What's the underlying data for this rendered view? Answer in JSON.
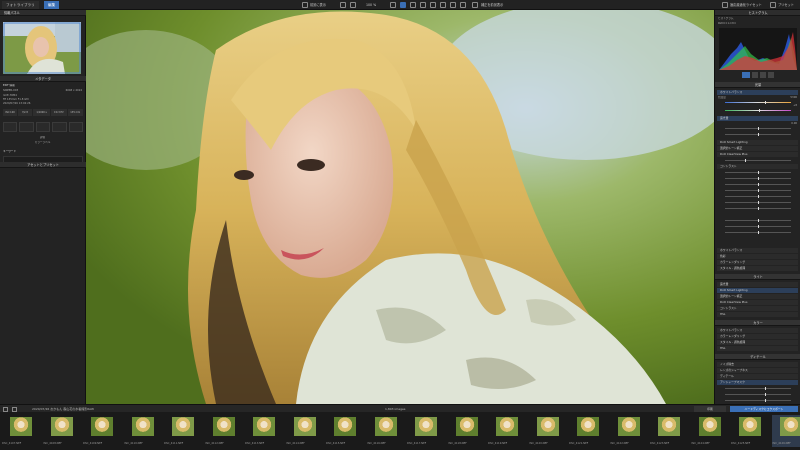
{
  "top_bar": {
    "tabs": [
      "フォトライブラリ",
      "編集"
    ],
    "buttons": [
      "前景に表示",
      "100 %",
      "補正を前景表示"
    ],
    "right_buttons": [
      "適応最適化ライセット",
      "プリセット"
    ]
  },
  "left_panel": {
    "title_navigator": "情報パネル",
    "metadata_header": "メタデータ",
    "exif_header": "EXIF 情報",
    "file_name": "SNIPER-003",
    "dims": "6048 x 4024",
    "camera": "ILCE-7RM4",
    "lens": "FE 135mm F1.8 GM",
    "date": "2020/07/26 13:02:26",
    "params": [
      "ISO 100",
      "f/2.8",
      "1/1000 s",
      "±0.3 EV",
      "135 mm"
    ],
    "keywords_header": "キーワード",
    "rating_label": "評価",
    "color_label": "カラーラベル",
    "assets_header": "アセットとプリセット"
  },
  "right_panel": {
    "histogram_header": "ヒストグラム",
    "histogram_label": "ヒストグラム",
    "histogram_info": "RGB R 0 G 0 B 0",
    "sections": [
      "ホワイトバランス",
      "露光量",
      "DxO Smart Lighting",
      "選択的トーン補正",
      "DxO ClearView Plus",
      "コントラスト",
      "ホワイトバランス",
      "色彩",
      "カラーレンダリング",
      "スタイル - 調色処理",
      "HSL",
      "ディテール",
      "ノイズ除去",
      "レンズのシャープネス",
      "アンシャープマスク"
    ],
    "group_headers": [
      "光量",
      "ライト",
      "カラー",
      "ディテール"
    ],
    "wb_values": [
      "5300",
      "+8"
    ],
    "exposure_value": "0.00",
    "export_button": "ハードディスクにエクスポート"
  },
  "filmstrip": {
    "folder": "2020/07/26 おかもん 森山花の水着撮影RAW",
    "count": "1,803 images",
    "print_button": "印刷",
    "thumbnails": [
      "DSC_4107.NEF",
      "DSC_4108.NEF",
      "DSC_4109.NEF",
      "DSC_4110.NEF",
      "DSC_4111.NEF",
      "DSC_4112.NEF",
      "DSC_4113.NEF",
      "DSC_4114.NEF",
      "DSC_4115.NEF",
      "DSC_4116.NEF",
      "DSC_4117.NEF",
      "DSC_4118.NEF",
      "DSC_4119.NEF",
      "DSC_4120.NEF",
      "DSC_4121.NEF",
      "DSC_4122.NEF",
      "DSC_4123.NEF",
      "DSC_4124.NEF",
      "DSC_4125.NEF",
      "DSC_4126.NEF"
    ]
  },
  "colors": {
    "accent": "#3a6fb6",
    "panel": "#232323",
    "background": "#1b1b1b"
  }
}
